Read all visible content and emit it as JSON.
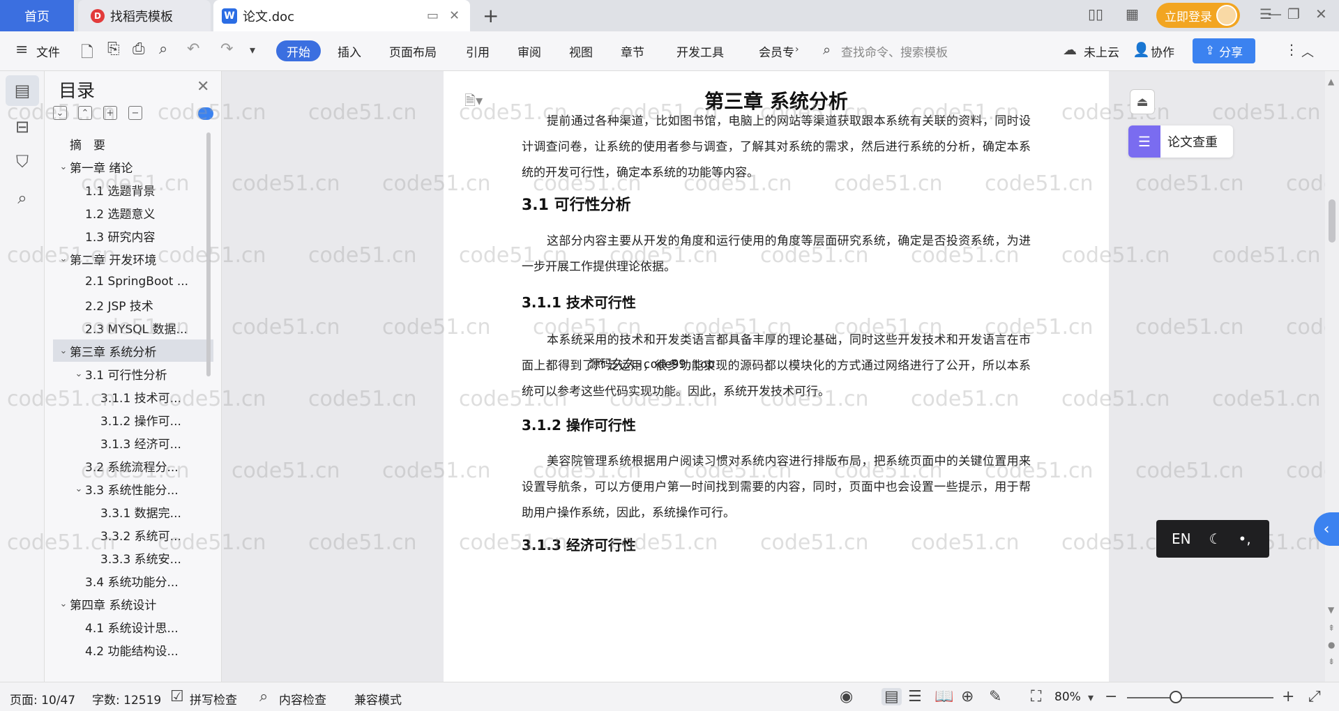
{
  "titlebar": {
    "home_tab": "首页",
    "templates_tab": "找稻壳模板",
    "doc_tab": "论文.doc",
    "login": "立即登录"
  },
  "toolbar": {
    "file": "文件",
    "tabs": [
      "开始",
      "插入",
      "页面布局",
      "引用",
      "审阅",
      "视图",
      "章节",
      "开发工具",
      "会员专"
    ],
    "search_placeholder": "查找命令、搜索模板",
    "cloud": "未上云",
    "collab": "协作",
    "share": "分享"
  },
  "outline": {
    "title": "目录",
    "items": [
      {
        "label": "摘　要",
        "level": 0,
        "caret": ""
      },
      {
        "label": "第一章  绪论",
        "level": 0,
        "caret": "v"
      },
      {
        "label": "1.1  选题背景",
        "level": 1,
        "caret": ""
      },
      {
        "label": "1.2  选题意义",
        "level": 1,
        "caret": ""
      },
      {
        "label": "1.3  研究内容",
        "level": 1,
        "caret": ""
      },
      {
        "label": "第二章  开发环境",
        "level": 0,
        "caret": "v"
      },
      {
        "label": "2.1 SpringBoot ...",
        "level": 1,
        "caret": ""
      },
      {
        "label": "2.2 JSP 技术",
        "level": 1,
        "caret": ""
      },
      {
        "label": "2.3 MYSQL 数据...",
        "level": 1,
        "caret": ""
      },
      {
        "label": "第三章  系统分析",
        "level": 0,
        "caret": "v",
        "active": true
      },
      {
        "label": "3.1 可行性分析",
        "level": 1,
        "caret": "v"
      },
      {
        "label": "3.1.1 技术可...",
        "level": 2,
        "caret": ""
      },
      {
        "label": "3.1.2 操作可...",
        "level": 2,
        "caret": ""
      },
      {
        "label": "3.1.3 经济可...",
        "level": 2,
        "caret": ""
      },
      {
        "label": "3.2 系统流程分...",
        "level": 1,
        "caret": ""
      },
      {
        "label": "3.3 系统性能分...",
        "level": 1,
        "caret": "v"
      },
      {
        "label": "3.3.1 数据完...",
        "level": 2,
        "caret": ""
      },
      {
        "label": "3.3.2 系统可...",
        "level": 2,
        "caret": ""
      },
      {
        "label": "3.3.3 系统安...",
        "level": 2,
        "caret": ""
      },
      {
        "label": "3.4 系统功能分...",
        "level": 1,
        "caret": ""
      },
      {
        "label": "第四章  系统设计",
        "level": 0,
        "caret": "v"
      },
      {
        "label": "4.1  系统设计思...",
        "level": 1,
        "caret": ""
      },
      {
        "label": "4.2 功能结构设...",
        "level": 1,
        "caret": ""
      }
    ]
  },
  "document": {
    "chapter_title": "第三章  系统分析",
    "intro": "提前通过各种渠道，比如图书馆，电脑上的网站等渠道获取跟本系统有关联的资料，同时设计调查问卷，让系统的使用者参与调查，了解其对系统的需求，然后进行系统的分析，确定本系统的开发可行性，确定本系统的功能等内容。",
    "h31": "3.1 可行性分析",
    "p31": "这部分内容主要从开发的角度和运行使用的角度等层面研究系统，确定是否投资系统，为进一步开展工作提供理论依据。",
    "h311": "3.1.1 技术可行性",
    "overlay": "源码久久-code99.top",
    "p311": "本系统采用的技术和开发类语言都具备丰厚的理论基础，同时这些开发技术和开发语言在市面上都得到了广泛运用，很多功能实现的源码都以模块化的方式通过网络进行了公开，所以本系统可以参考这些代码实现功能。因此，系统开发技术可行。",
    "h312": "3.1.2 操作可行性",
    "p312": "美容院管理系统根据用户阅读习惯对系统内容进行排版布局，把系统页面中的关键位置用来设置导航条，可以方便用户第一时间找到需要的内容，同时，页面中也会设置一些提示，用于帮助用户操作系统，因此，系统操作可行。",
    "h313": "3.1.3 经济可行性"
  },
  "right_panel": {
    "paper_check": "论文查重",
    "ime_label": "EN"
  },
  "watermark": "code51.cn",
  "statusbar": {
    "page": "页面: 10/47",
    "words": "字数: 12519",
    "spell": "拼写检查",
    "content": "内容检查",
    "compat": "兼容模式",
    "zoom": "80%",
    "zoom_value": 0.8
  }
}
